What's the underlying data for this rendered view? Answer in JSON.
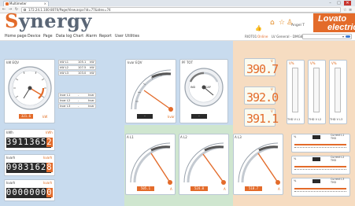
{
  "browser": {
    "tab_title": "Multimeter",
    "url": "172.24.1.100:8070/Page/View.aspx?id=77&idev=74",
    "nav": [
      "←",
      "→",
      "↻"
    ],
    "window_controls": [
      "–",
      "□",
      "✕"
    ]
  },
  "header": {
    "logo_s": "S",
    "logo_rest": "ynergy",
    "user_label": "Angel T",
    "brand_line1": "Lovato",
    "brand_line2": "electric",
    "icons": [
      "thumbs-icon",
      "home-icon",
      "star-icon",
      "user-icon"
    ]
  },
  "menu": {
    "items": [
      "Home page",
      "Device",
      "Page",
      "Data log",
      "Chart",
      "Alarm",
      "Report",
      "User",
      "Utilities"
    ],
    "station_label": "RIOT01",
    "station_status": "Online",
    "station_name": "LV General - DMG800"
  },
  "colors": {
    "accent": "#e36b2a",
    "blue_zone": "#c8dbee",
    "green_zone": "#cfe6cf",
    "peach_zone": "#f6dcc1"
  },
  "panels": {
    "kw": {
      "title": "kW EQV",
      "display": "321.6",
      "unit": "kW",
      "rows": [
        {
          "label": "kW L1",
          "value": "105.1",
          "unit": "kW"
        },
        {
          "label": "kW L2",
          "value": "107.5",
          "unit": "kW"
        },
        {
          "label": "kW L3",
          "value": "103.0",
          "unit": "kW"
        }
      ],
      "rows2": [
        {
          "label": "kvar L1",
          "value": "-",
          "unit": "kvar"
        },
        {
          "label": "kvar L2",
          "value": "-",
          "unit": "kvar"
        },
        {
          "label": "kvar L3",
          "value": "-",
          "unit": "kvar"
        }
      ]
    },
    "kvar": {
      "title": "kvar EQV",
      "display": "-",
      "unit": "kvar"
    },
    "pf": {
      "title": "PF TOT",
      "display": "-",
      "labels": [
        "IND",
        "CAP"
      ]
    },
    "voltages": [
      "390.7",
      "392.0",
      "391.1"
    ],
    "v_unit": "V",
    "thd": [
      {
        "label": "THD V L1",
        "unit": "V%"
      },
      {
        "label": "THD V L2",
        "unit": "V%"
      },
      {
        "label": "THD V L3",
        "unit": "V%"
      }
    ],
    "counters": [
      {
        "title": "kWh",
        "unit": "kWh",
        "value": "3911365",
        "last": "2"
      },
      {
        "title": "kvarh",
        "unit": "kvarh",
        "value": "0983162",
        "last": "8"
      },
      {
        "title": "kvarh",
        "unit": "kvarh",
        "value": "0000000",
        "last": "0"
      }
    ],
    "currents": [
      {
        "title": "A L1",
        "display": "505.1",
        "unit": "A"
      },
      {
        "title": "A L2",
        "display": "524.0",
        "unit": "A"
      },
      {
        "title": "A L3",
        "display": "518.7",
        "unit": "A"
      }
    ],
    "current_thd": [
      {
        "label": "Current L1 THD",
        "prefix": "%"
      },
      {
        "label": "Current L2 THD",
        "prefix": "%"
      },
      {
        "label": "Current L3 THD",
        "prefix": "%"
      }
    ]
  }
}
